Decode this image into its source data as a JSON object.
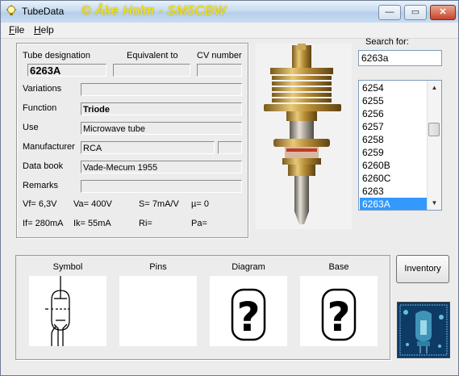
{
  "window": {
    "title": "TubeData",
    "banner": "© Åke Holm - SM5CBW",
    "controls": {
      "minimize": "—",
      "maximize": "▭",
      "close": "✕"
    }
  },
  "menu": [
    {
      "label_u": "F",
      "label_rest": "ile"
    },
    {
      "label_u": "H",
      "label_rest": "elp"
    }
  ],
  "tube": {
    "designation_label": "Tube designation",
    "equivalent_label": "Equivalent to",
    "cv_label": "CV number",
    "designation": "6263A",
    "equivalent": "",
    "cv_number": "",
    "variations_label": "Variations",
    "variations": "",
    "function_label": "Function",
    "function": "Triode",
    "use_label": "Use",
    "use": "Microwave tube",
    "manufacturer_label": "Manufacturer",
    "manufacturer": "RCA",
    "manufacturer_extra": "",
    "databook_label": "Data book",
    "databook": "Vade-Mecum 1955",
    "remarks_label": "Remarks",
    "remarks": ""
  },
  "specs": {
    "vf": "Vf= 6,3V",
    "va": "Va=  400V",
    "s": "S= 7mA/V",
    "mu": "µ=    0",
    "if": "If= 280mA",
    "ik": "Ik=  55mA",
    "ri": "Ri=",
    "pa": "Pa="
  },
  "search": {
    "label": "Search for:",
    "value": "6263a"
  },
  "list": {
    "items": [
      "6254",
      "6255",
      "6256",
      "6257",
      "6258",
      "6259",
      "6260B",
      "6260C",
      "6263",
      "6263A"
    ],
    "selected_index": 9
  },
  "scrollbar": {
    "up": "▲",
    "down": "▼"
  },
  "panels": {
    "symbol": "Symbol",
    "pins": "Pins",
    "diagram": "Diagram",
    "base": "Base",
    "diagram_glyph": "?",
    "base_glyph": "?"
  },
  "inventory_button": "Inventory",
  "colors": {
    "selection": "#3399ff",
    "banner": "#ffe600"
  }
}
